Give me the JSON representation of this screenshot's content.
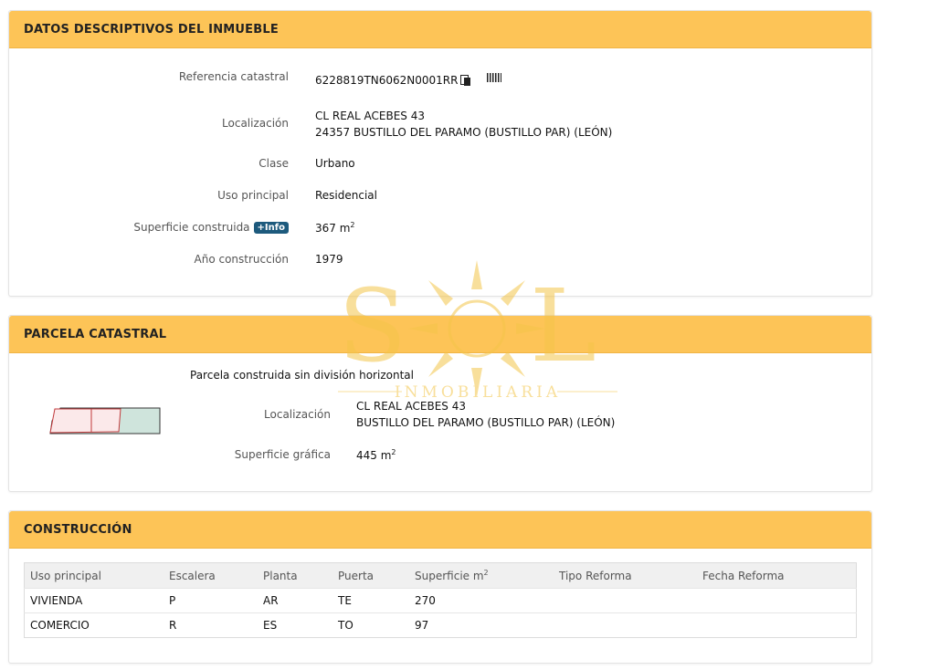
{
  "datos": {
    "title": "DATOS DESCRIPTIVOS DEL INMUEBLE",
    "ref_label": "Referencia catastral",
    "ref_value": "6228819TN6062N0001RR",
    "loc_label": "Localización",
    "loc_line1": "CL REAL ACEBES 43",
    "loc_line2": "24357 BUSTILLO DEL PARAMO (BUSTILLO PAR) (LEÓN)",
    "clase_label": "Clase",
    "clase_value": "Urbano",
    "uso_label": "Uso principal",
    "uso_value": "Residencial",
    "sup_label": "Superficie construida",
    "info_badge": "+Info",
    "sup_value": "367 m",
    "sup_unit_exp": "2",
    "anio_label": "Año construcción",
    "anio_value": "1979"
  },
  "parcela": {
    "title": "PARCELA CATASTRAL",
    "subtitle": "Parcela construida sin división horizontal",
    "loc_label": "Localización",
    "loc_line1": "CL REAL ACEBES 43",
    "loc_line2": "BUSTILLO DEL PARAMO (BUSTILLO PAR) (LEÓN)",
    "sup_label": "Superficie gráfica",
    "sup_value": "445 m",
    "sup_unit_exp": "2"
  },
  "construccion": {
    "title": "CONSTRUCCIÓN",
    "headers": [
      "Uso principal",
      "Escalera",
      "Planta",
      "Puerta",
      "Superficie m",
      "Tipo Reforma",
      "Fecha Reforma"
    ],
    "superficie_exp": "2",
    "rows": [
      [
        "VIVIENDA",
        "P",
        "AR",
        "TE",
        "270",
        "",
        ""
      ],
      [
        "COMERCIO",
        "R",
        "ES",
        "TO",
        "97",
        "",
        ""
      ]
    ]
  },
  "watermark": {
    "brand": "SOL",
    "tagline": "INMOBILIARIA",
    "color": "#f4c54a"
  },
  "icons": [
    "copy-icon",
    "barcode-icon",
    "parcel-map-thumbnail"
  ]
}
